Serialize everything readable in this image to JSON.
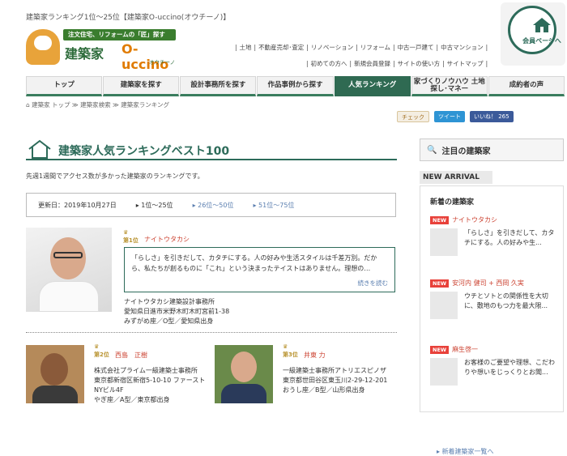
{
  "header": {
    "site_desc": "建築家ランキング1位〜25位【建築家O-uccino(オウチーノ)】",
    "logo_tag": "注文住宅、リフォームの「匠」探すなら",
    "logo_brand": "建築家",
    "logo_brand2": "O-uccino",
    "logo_kana": "オウチーノ",
    "links_row1": [
      "土地",
      "不動産売却･査定",
      "リノベーション",
      "リフォーム",
      "中古一戸建て",
      "中古マンション"
    ],
    "links_row2": [
      "初めての方へ",
      "新規会員登録",
      "サイトの使い方",
      "サイトマップ"
    ],
    "member_label": "会員ページへ"
  },
  "nav": [
    "トップ",
    "建築家を探す",
    "設計事務所を探す",
    "作品事例から探す",
    "人気ランキング",
    "家づくりノウハウ 土地探し･マネー",
    "成約者の声"
  ],
  "breadcrumb": "建築家 トップ ≫ 建築家検索 ≫ 建築家ランキング",
  "social": {
    "check": "チェック",
    "tweet": "ツイート",
    "like": "いいね！ 265"
  },
  "page_title": "建築家人気ランキングベスト100",
  "intro": "先週1週間でアクセス数が多かった建築家のランキングです。",
  "updated": "更新日：2019年10月27日",
  "pages": [
    "1位〜25位",
    "26位〜50位",
    "51位〜75位"
  ],
  "rank1": {
    "crown": "第1位",
    "name": "ナイトウタカシ",
    "quote": "「らしさ」を引きだして、カタチにする。人の好みや生活スタイルは千差万別。だから、私たちが創るものに「これ」という決まったテイストはありません。理想の…",
    "more": "続きを読む",
    "office": "ナイトウタカシ建築設計事務所",
    "address": "愛知県日進市米野木町木町宮前1-38",
    "meta": "みずがめ座／O型／愛知県出身"
  },
  "rank2": {
    "crown": "第2位",
    "name": "西島　正樹",
    "office": "株式会社プライム一級建築士事務所",
    "address": "東京都新宿区新宿5-10-10 ファーストNYビル4F",
    "meta": "やぎ座／A型／東京都出身"
  },
  "rank3": {
    "crown": "第3位",
    "name": "井東 力",
    "office": "一級建築士事務所アトリエスピノザ",
    "address": "東京都世田谷区東玉川2-29-12-201",
    "meta": "おうし座／B型／山形県出身"
  },
  "sidebar": {
    "head": "注目の建築家",
    "new_arrival": "NEW ARRIVAL",
    "new_head": "新着の建築家",
    "badge": "NEW",
    "items": [
      {
        "name": "ナイトウタカシ",
        "text": "「らしさ」を引きだして、カタチにする。人の好みや生..."
      },
      {
        "name": "安河内 健司 + 西岡 久実",
        "text": "ウチとソトとの関係性を大切に、敷地のもつ力を最大限..."
      },
      {
        "name": "麻生啓一",
        "text": "お客様のご要望や理想、こだわりや想いをじっくりとお聞..."
      }
    ],
    "more": "新着建築家一覧へ"
  }
}
